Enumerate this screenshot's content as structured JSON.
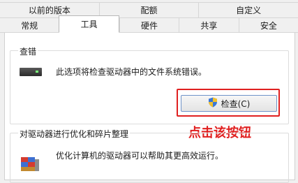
{
  "tabs_row1": [
    {
      "label": "以前的版本"
    },
    {
      "label": "配额"
    },
    {
      "label": "自定义"
    }
  ],
  "tabs_row2": [
    {
      "label": "常规"
    },
    {
      "label": "工具",
      "active": true
    },
    {
      "label": "硬件"
    },
    {
      "label": "共享"
    },
    {
      "label": "安全"
    }
  ],
  "error_check": {
    "title": "查错",
    "description": "此选项将检查驱动器中的文件系统错误。",
    "button_label": "检查(C)",
    "icon": "shield-icon"
  },
  "optimize": {
    "title": "对驱动器进行优化和碎片整理",
    "description": "优化计算机的驱动器可以帮助其更高效运行。",
    "icon": "defrag-icon"
  },
  "annotation": {
    "text": "点击该按钮",
    "color": "#e02020"
  },
  "colors": {
    "panel_bg": "#ffffff",
    "window_bg": "#f0f0f0",
    "button_border": "#6f93c9"
  }
}
